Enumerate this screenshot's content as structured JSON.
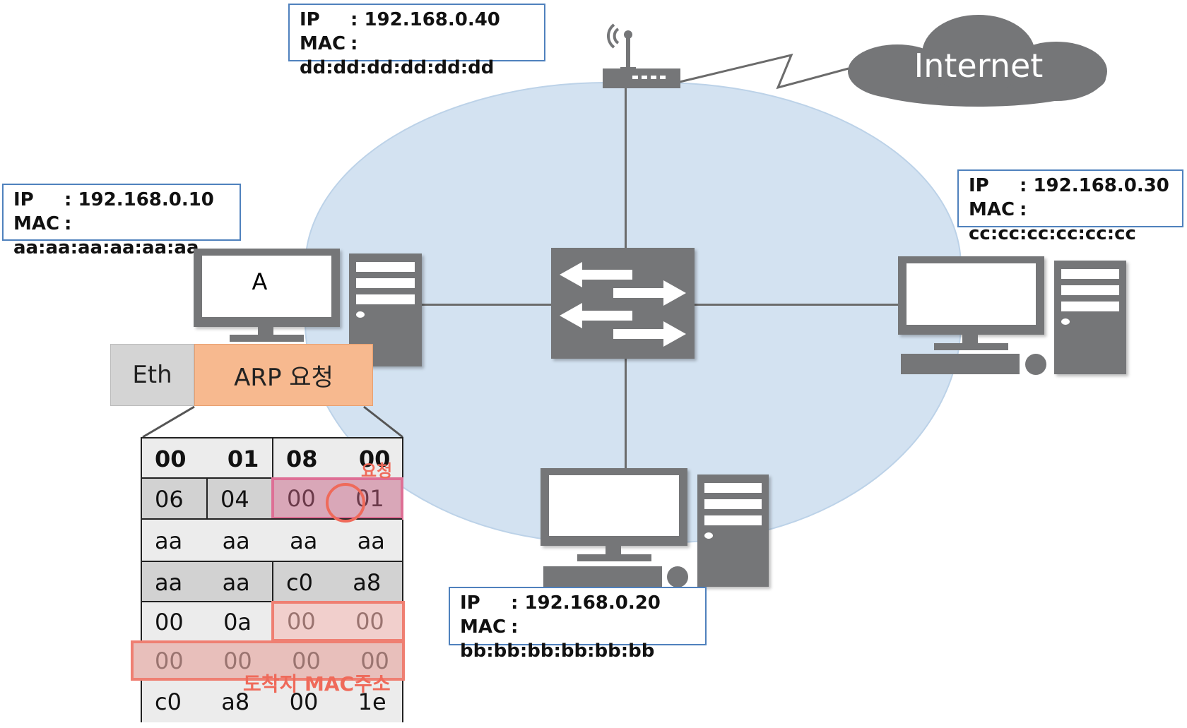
{
  "hosts": {
    "router": {
      "ip_label": "IP",
      "ip": ": 192.168.0.40",
      "mac_label": "MAC",
      "mac": ": dd:dd:dd:dd:dd:dd"
    },
    "a": {
      "name": "A",
      "ip_label": "IP",
      "ip": ": 192.168.0.10",
      "mac_label": "MAC",
      "mac": ": aa:aa:aa:aa:aa:aa"
    },
    "c": {
      "ip_label": "IP",
      "ip": ": 192.168.0.30",
      "mac_label": "MAC",
      "mac": ": cc:cc:cc:cc:cc:cc"
    },
    "b": {
      "ip_label": "IP",
      "ip": ": 192.168.0.20",
      "mac_label": "MAC",
      "mac": ": bb:bb:bb:bb:bb:bb"
    }
  },
  "internet": "Internet",
  "frame": {
    "eth": "Eth",
    "arp": "ARP 요청"
  },
  "packet": {
    "rows": [
      [
        "00  01",
        "08  00"
      ],
      [
        "06",
        "04",
        "00  01"
      ],
      [
        "aa  aa  aa  aa"
      ],
      [
        "aa  aa",
        "c0  a8"
      ],
      [
        "00  0a",
        "00  00"
      ],
      [
        "00  00  00  00"
      ],
      [
        "c0  a8  00  1e"
      ]
    ],
    "annotations": {
      "opcode": "요청",
      "target_mac": "도착지 MAC주소"
    }
  },
  "colors": {
    "lan": "#d3e2f1",
    "device": "#757678",
    "arp": "#f7b98f",
    "highlight_pink": "#d9a7b8",
    "highlight_red": "#ef6a5a"
  }
}
